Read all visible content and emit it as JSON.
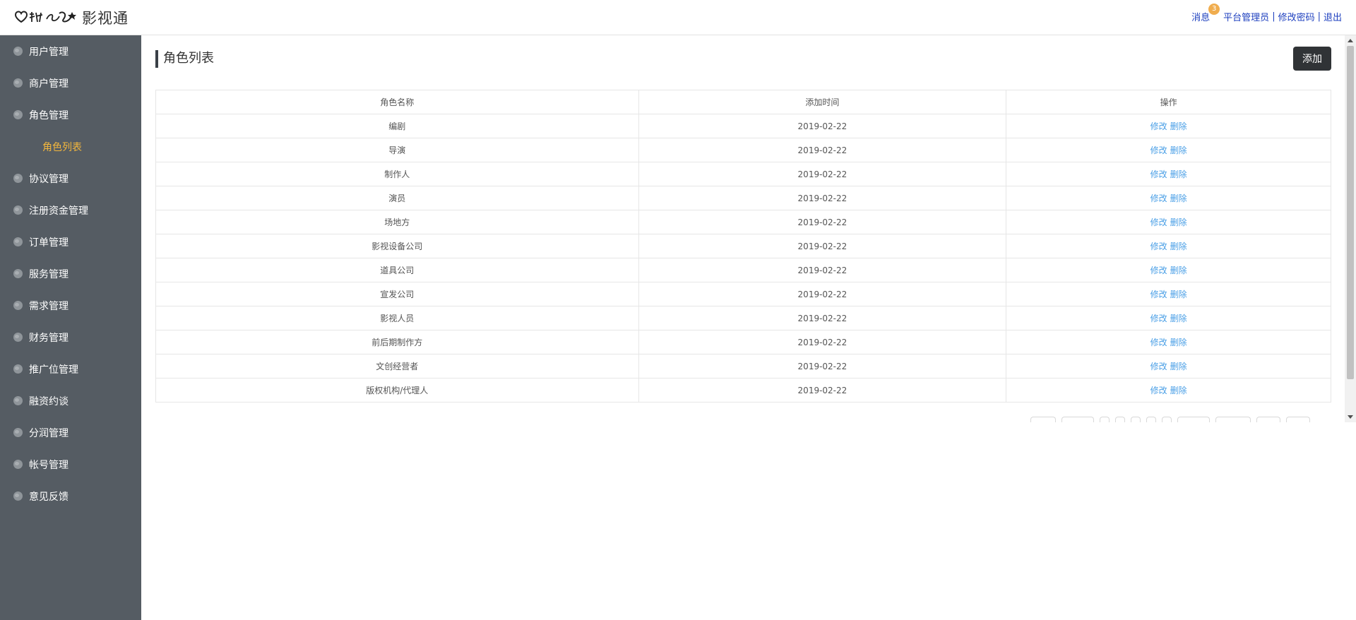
{
  "header": {
    "brand": "影视通",
    "logo_icon": "heart-logo-icon",
    "messages_label": "消息",
    "messages_badge": "3",
    "role_label": "平台管理员",
    "change_password_label": "修改密码",
    "logout_label": "退出",
    "separator": "|",
    "link_color": "#1d3fbf",
    "badge_color": "#f0ad4e"
  },
  "sidebar": {
    "background": "#555c63",
    "active_color": "#f3b73d",
    "items": [
      {
        "label": "用户管理"
      },
      {
        "label": "商户管理"
      },
      {
        "label": "角色管理",
        "children": [
          {
            "label": "角色列表",
            "active": true
          }
        ]
      },
      {
        "label": "协议管理"
      },
      {
        "label": "注册资金管理"
      },
      {
        "label": "订单管理"
      },
      {
        "label": "服务管理"
      },
      {
        "label": "需求管理"
      },
      {
        "label": "财务管理"
      },
      {
        "label": "推广位管理"
      },
      {
        "label": "融资约谈"
      },
      {
        "label": "分润管理"
      },
      {
        "label": "帐号管理"
      },
      {
        "label": "意见反馈"
      }
    ]
  },
  "main": {
    "title": "角色列表",
    "add_button": "添加",
    "table": {
      "columns": [
        "角色名称",
        "添加时间",
        "操作"
      ],
      "edit_label": "修改",
      "delete_label": "删除",
      "rows": [
        {
          "name": "编剧",
          "date": "2019-02-22"
        },
        {
          "name": "导演",
          "date": "2019-02-22"
        },
        {
          "name": "制作人",
          "date": "2019-02-22"
        },
        {
          "name": "演员",
          "date": "2019-02-22"
        },
        {
          "name": "场地方",
          "date": "2019-02-22"
        },
        {
          "name": "影视设备公司",
          "date": "2019-02-22"
        },
        {
          "name": "道具公司",
          "date": "2019-02-22"
        },
        {
          "name": "宣发公司",
          "date": "2019-02-22"
        },
        {
          "name": "影视人员",
          "date": "2019-02-22"
        },
        {
          "name": "前后期制作方",
          "date": "2019-02-22"
        },
        {
          "name": "文创经营者",
          "date": "2019-02-22"
        },
        {
          "name": "版权机构/代理人",
          "date": "2019-02-22"
        }
      ]
    },
    "pagination_count": 11
  }
}
